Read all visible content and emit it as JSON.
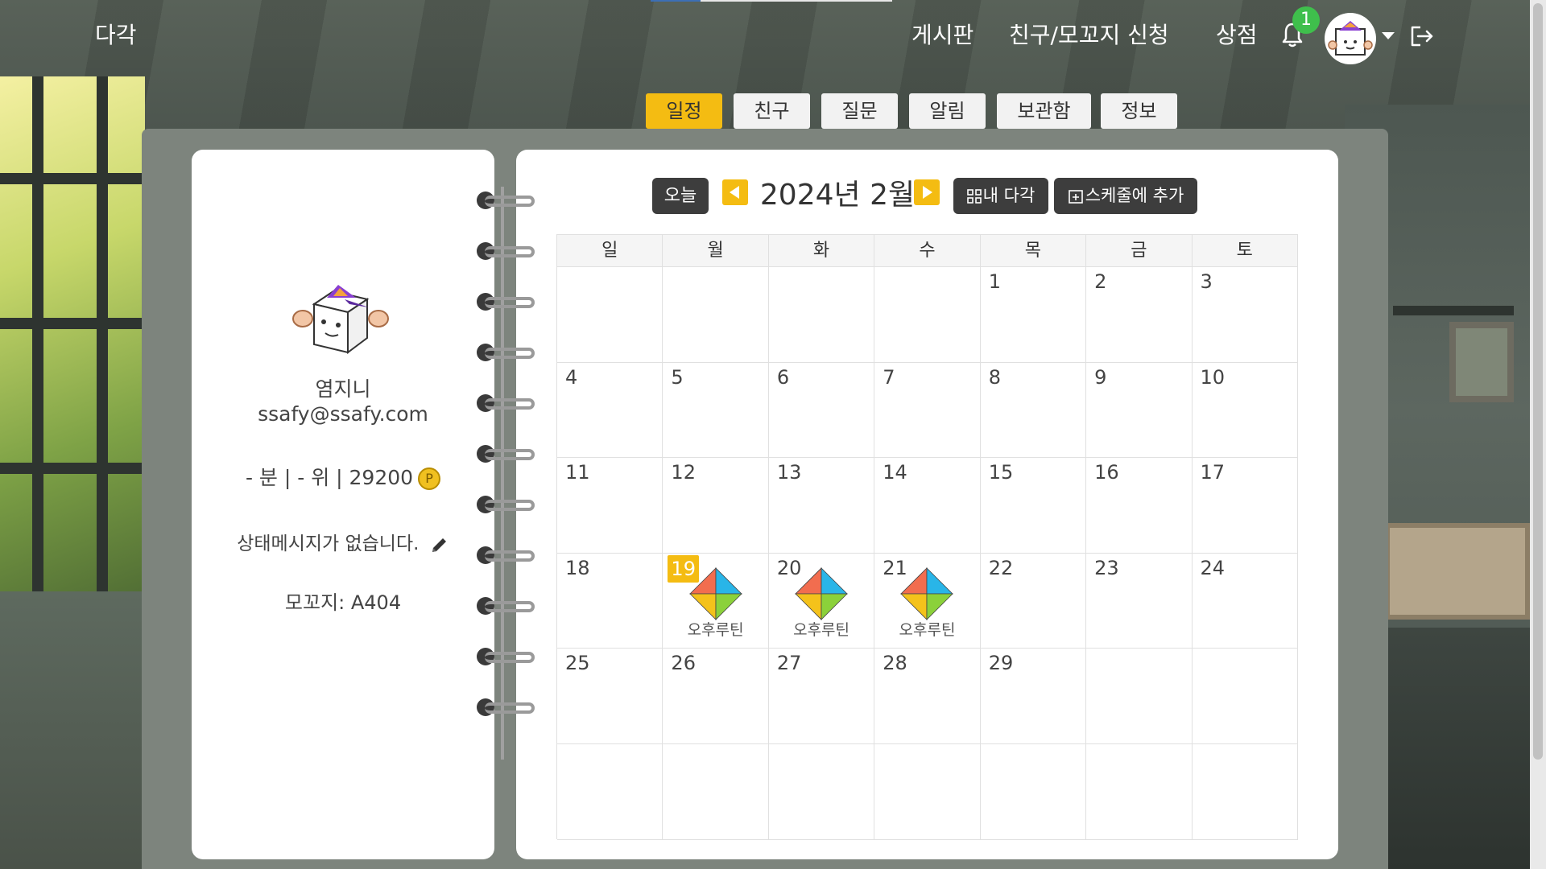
{
  "header": {
    "logo": "다각",
    "nav": [
      "게시판",
      "친구/모꼬지 신청",
      "상점"
    ],
    "notification_count": "1"
  },
  "tabs": [
    {
      "label": "일정",
      "active": true
    },
    {
      "label": "친구",
      "active": false
    },
    {
      "label": "질문",
      "active": false
    },
    {
      "label": "알림",
      "active": false
    },
    {
      "label": "보관함",
      "active": false
    },
    {
      "label": "정보",
      "active": false
    }
  ],
  "profile": {
    "name": "염지니",
    "email": "ssafy@ssafy.com",
    "stats": "- 분 | - 위 | 29200",
    "coin_symbol": "P",
    "status_message": "상태메시지가 없습니다.",
    "mokkoji": "모꼬지: A404"
  },
  "calendar": {
    "today_button": "오늘",
    "month_title": "2024년 2월",
    "my_dagak_button": "내 다각",
    "add_schedule_button": "스케줄에 추가",
    "weekdays": [
      "일",
      "월",
      "화",
      "수",
      "목",
      "금",
      "토"
    ],
    "weeks": [
      [
        "",
        "",
        "",
        "",
        "1",
        "2",
        "3"
      ],
      [
        "4",
        "5",
        "6",
        "7",
        "8",
        "9",
        "10"
      ],
      [
        "11",
        "12",
        "13",
        "14",
        "15",
        "16",
        "17"
      ],
      [
        "18",
        "19",
        "20",
        "21",
        "22",
        "23",
        "24"
      ],
      [
        "25",
        "26",
        "27",
        "28",
        "29",
        "",
        ""
      ],
      [
        "",
        "",
        "",
        "",
        "",
        "",
        ""
      ]
    ],
    "today": "19",
    "events": [
      {
        "day": "19",
        "label": "오후루틴"
      },
      {
        "day": "20",
        "label": "오후루틴"
      },
      {
        "day": "21",
        "label": "오후루틴"
      }
    ],
    "event_colors": [
      "#f26d4f",
      "#29b5e8",
      "#f4c21b",
      "#8bd13a"
    ]
  }
}
